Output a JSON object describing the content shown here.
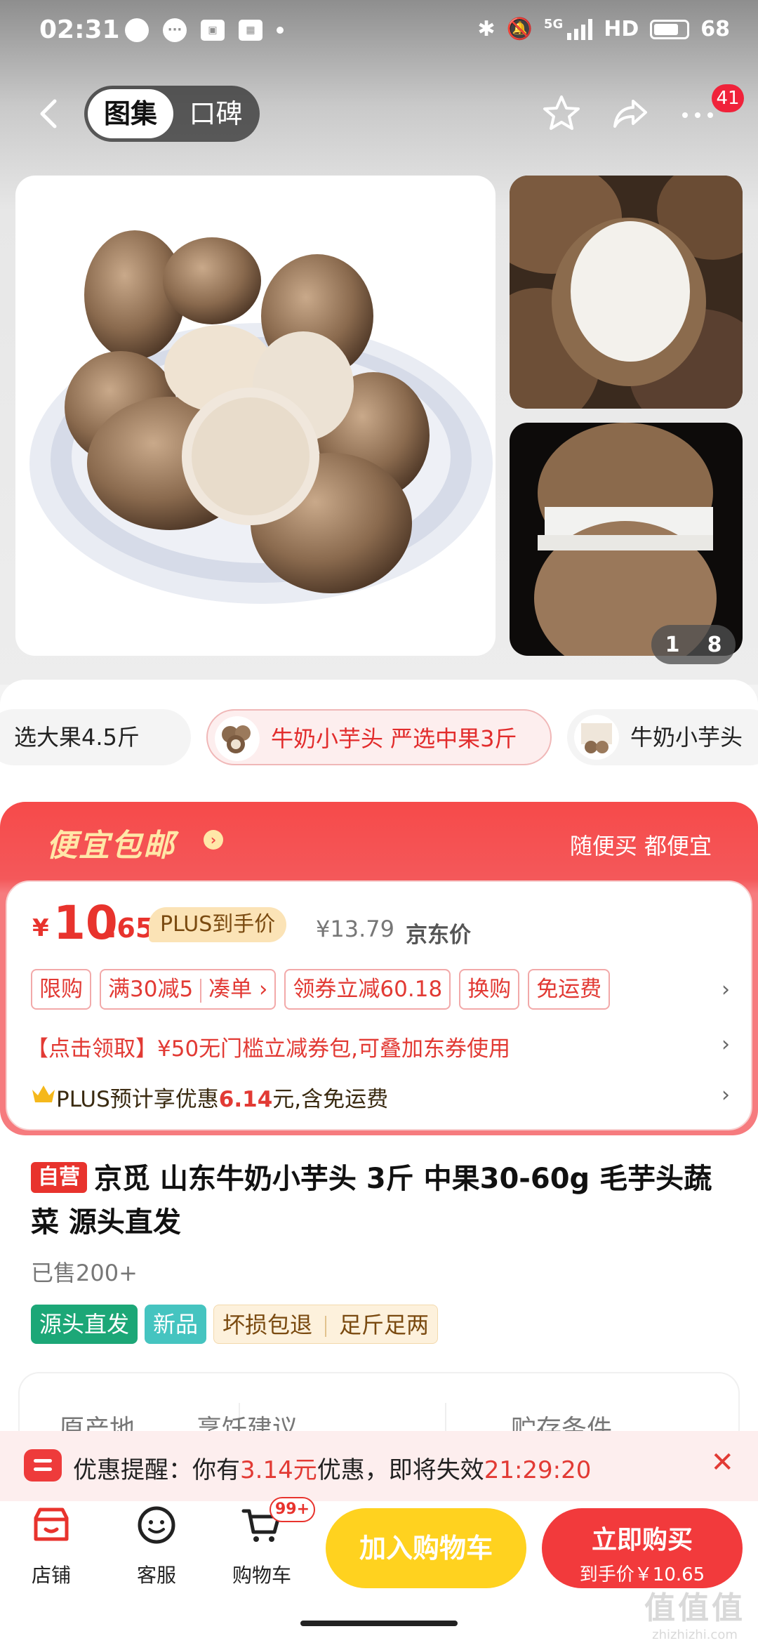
{
  "status_bar": {
    "time": "02:31",
    "network": "5G",
    "hd": "HD",
    "battery": "68"
  },
  "nav": {
    "tab_active": "图集",
    "tab_inactive": "口碑",
    "notification_count": "41"
  },
  "gallery": {
    "pager_current": "1",
    "pager_total": "8"
  },
  "variants": [
    {
      "label": "选大果4.5斤"
    },
    {
      "label": "牛奶小芋头 严选中果3斤",
      "selected": true
    },
    {
      "label": "牛奶小芋头"
    }
  ],
  "promo": {
    "title": "便宜包邮",
    "slogan": "随便买 都便宜",
    "price_symbol": "¥",
    "price_int": "10",
    "price_dec": ".65",
    "plus_price_tag": "PLUS到手价",
    "original_price": "¥13.79",
    "original_price_label": "京东价",
    "coupons": [
      "限购",
      "满30减5",
      "凑单 ›",
      "领券立减60.18",
      "换购",
      "免运费"
    ],
    "coupon_pack": "【点击领取】¥50无门槛立减券包,可叠加东券使用",
    "plus_line_prefix": "PLUS预计享优惠",
    "plus_line_amount": "6.14",
    "plus_line_suffix": "元,含免运费"
  },
  "product": {
    "self_operated_tag": "自营",
    "title": "京觅 山东牛奶小芋头 3斤 中果30-60g 毛芋头蔬菜 源头直发",
    "sold": "已售200+",
    "tags": [
      "源头直发",
      "新品",
      "坏损包退",
      "足斤足两"
    ]
  },
  "attributes": [
    "原产地",
    "烹饪建议",
    "贮存条件"
  ],
  "reminder": {
    "prefix": "优惠提醒：你有",
    "amount": "3.14元",
    "middle": "优惠，即将失效",
    "countdown": "21:29:20"
  },
  "bottom_bar": {
    "store": "店铺",
    "service": "客服",
    "cart": "购物车",
    "cart_badge": "99+",
    "add_to_cart": "加入购物车",
    "buy_now": "立即购买",
    "buy_now_price": "到手价￥10.65"
  },
  "watermark": {
    "logo": "值值值",
    "site": "zhizhizhi.com"
  },
  "colors": {
    "brand_red": "#e8332d",
    "cart_yellow": "#ffd21f",
    "gold": "#ffe7a8"
  }
}
